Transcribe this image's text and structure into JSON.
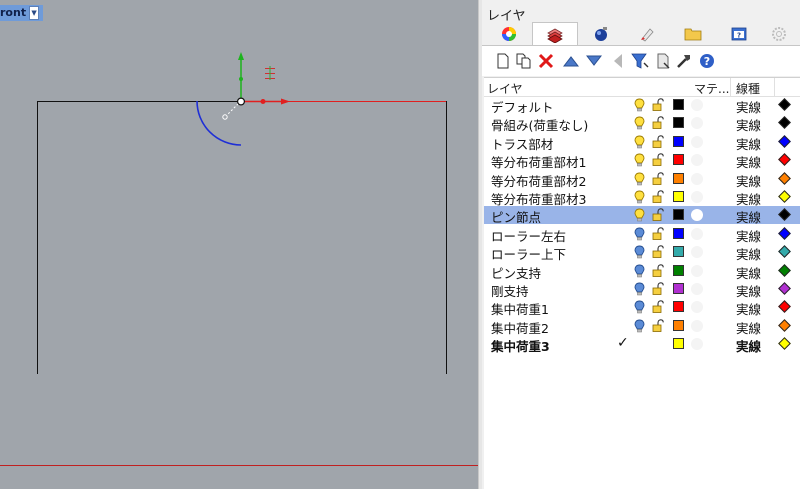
{
  "viewport": {
    "title": "ront",
    "colors": {
      "background": "#a0a5ab",
      "axis_x": "#e02020",
      "axis_y": "#1db31d",
      "arc": "#1f2fd6"
    }
  },
  "panel": {
    "title": "レイヤ",
    "tabs": [
      "color-wheel-icon",
      "layers-icon",
      "render-sphere-icon",
      "paint-tube-icon",
      "folder-icon",
      "help-window-icon",
      "settings-gear-icon"
    ],
    "toolbar": [
      "new-layer-icon",
      "new-sublayer-icon",
      "delete-icon",
      "move-up-icon",
      "move-down-icon",
      "move-left-icon",
      "filter-icon",
      "document-icon",
      "tools-icon",
      "help-icon"
    ],
    "columns": {
      "layer": "レイヤ",
      "material": "マテ...",
      "linetype": "線種"
    },
    "selected_color": "#99b4e8",
    "layers": [
      {
        "name": "デフォルト",
        "color": "#000000",
        "linetype": "実線",
        "light": "yellow"
      },
      {
        "name": "骨組み(荷重なし)",
        "color": "#000000",
        "linetype": "実線",
        "light": "yellow"
      },
      {
        "name": "トラス部材",
        "color": "#0000ff",
        "linetype": "実線",
        "light": "yellow"
      },
      {
        "name": "等分布荷重部材1",
        "color": "#ff0000",
        "linetype": "実線",
        "light": "yellow"
      },
      {
        "name": "等分布荷重部材2",
        "color": "#ff8000",
        "linetype": "実線",
        "light": "yellow"
      },
      {
        "name": "等分布荷重部材3",
        "color": "#ffff00",
        "linetype": "実線",
        "light": "yellow"
      },
      {
        "name": "ピン節点",
        "color": "#000000",
        "linetype": "実線",
        "light": "yellow",
        "selected": true
      },
      {
        "name": "ローラー左右",
        "color": "#0000ff",
        "linetype": "実線",
        "light": "blue"
      },
      {
        "name": "ローラー上下",
        "color": "#33aaaa",
        "linetype": "実線",
        "light": "blue"
      },
      {
        "name": "ピン支持",
        "color": "#008000",
        "linetype": "実線",
        "light": "blue"
      },
      {
        "name": "剛支持",
        "color": "#b030d0",
        "linetype": "実線",
        "light": "blue"
      },
      {
        "name": "集中荷重1",
        "color": "#ff0000",
        "linetype": "実線",
        "light": "blue"
      },
      {
        "name": "集中荷重2",
        "color": "#ff8000",
        "linetype": "実線",
        "light": "blue"
      },
      {
        "name": "集中荷重3",
        "color": "#ffff00",
        "linetype": "実線",
        "current": true,
        "check": "✓"
      }
    ]
  }
}
